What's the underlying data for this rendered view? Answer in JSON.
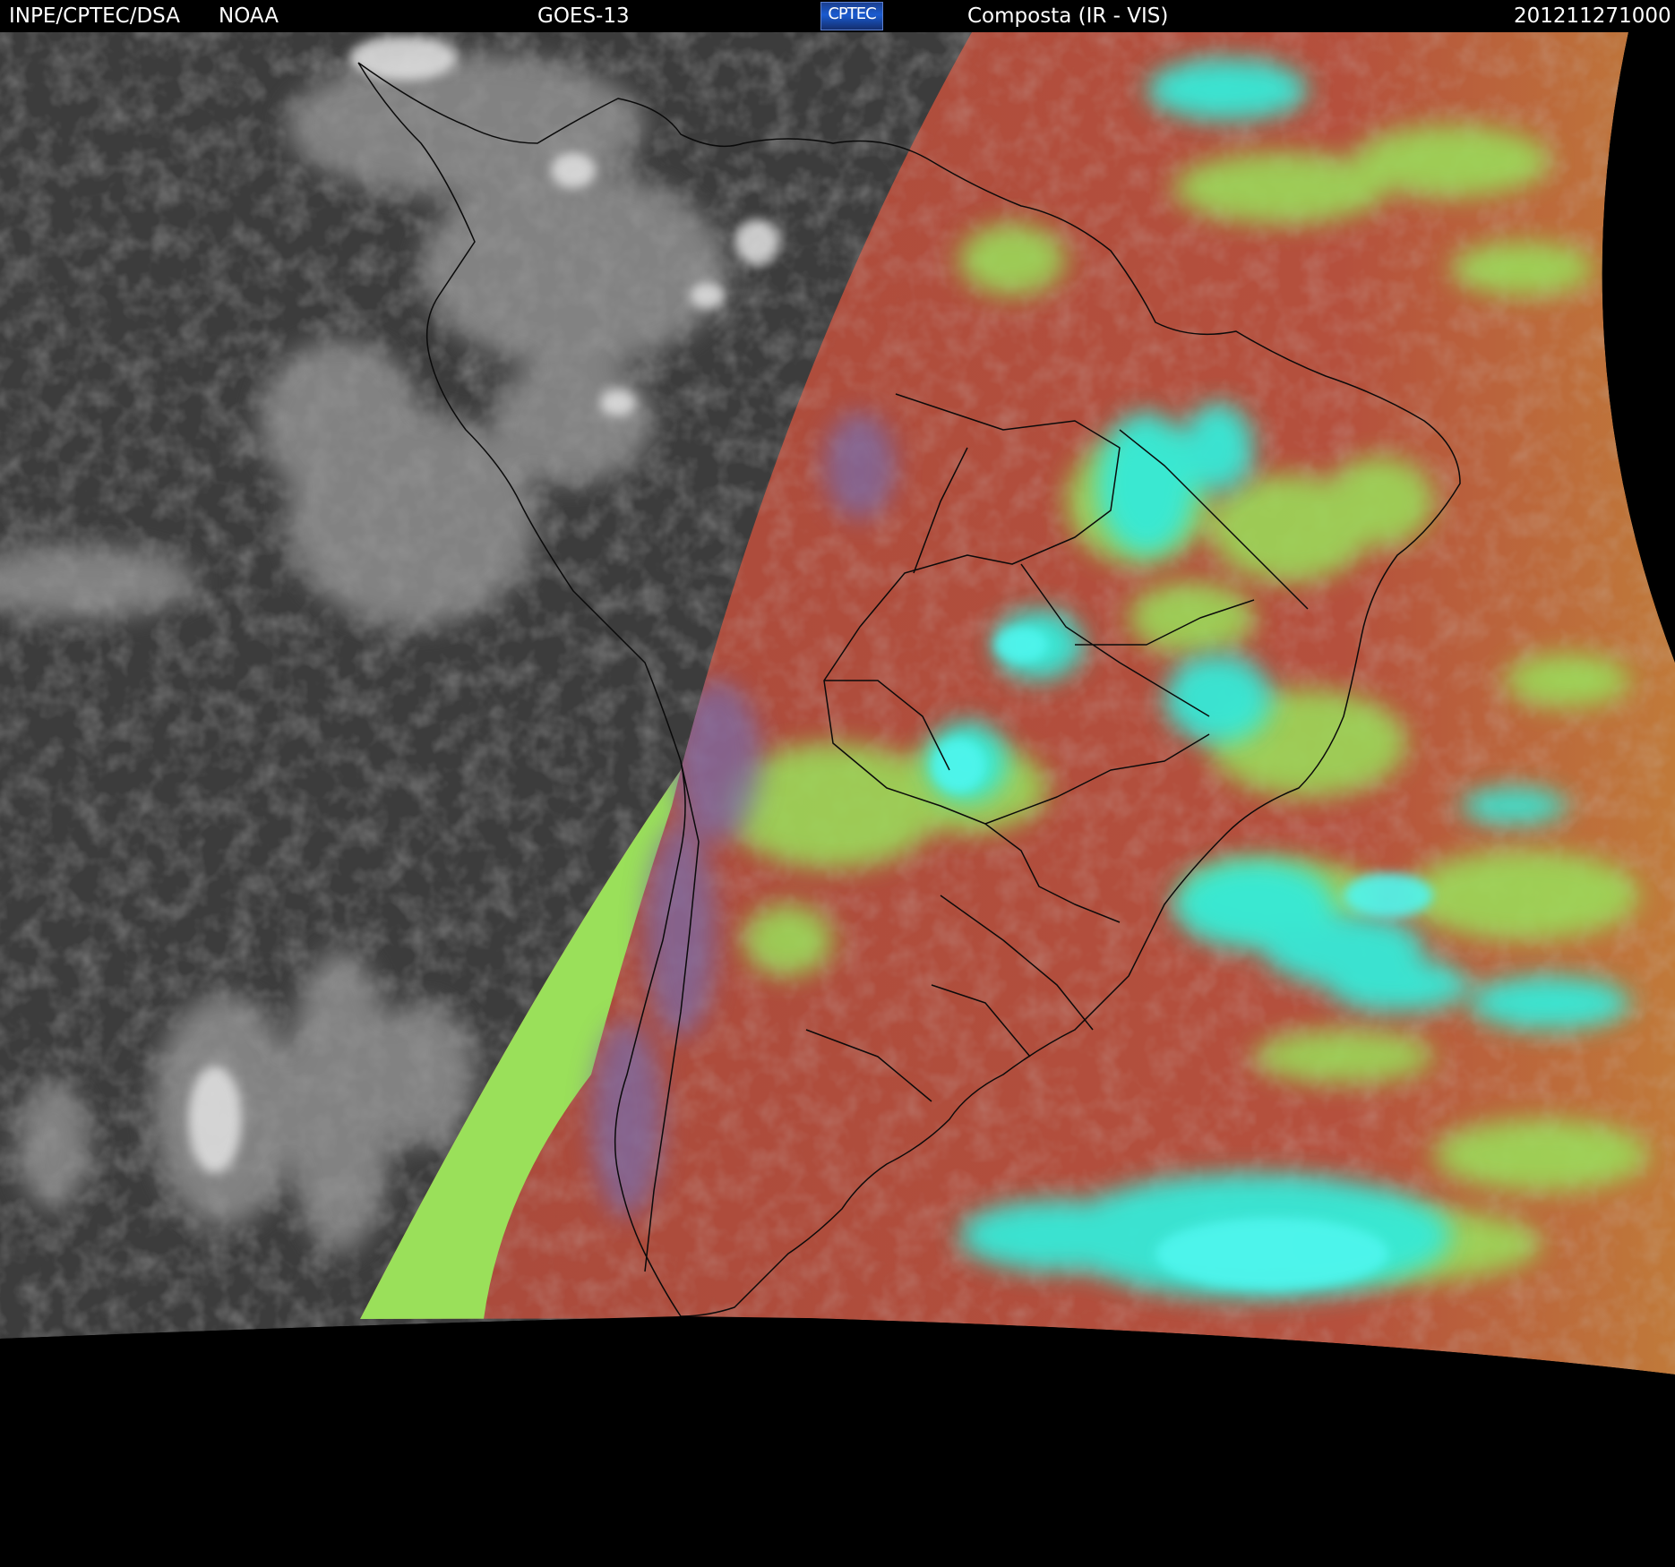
{
  "header": {
    "agency": "INPE/CPTEC/DSA",
    "partner": "NOAA",
    "satellite": "GOES-13",
    "logo_text": "CPTEC",
    "product": "Composta (IR - VIS)",
    "timestamp": "201211271000"
  },
  "map": {
    "region": "South America",
    "colors": {
      "night_background": "#3c3c3c",
      "night_clouds": "#bdbdbd",
      "day_surface": "#b14a3f",
      "low_clouds": "#9ae05a",
      "high_clouds": "#35ead8",
      "mid_clouds": "#7a6aa6",
      "space": "#000000",
      "coastline": "#000000"
    }
  }
}
